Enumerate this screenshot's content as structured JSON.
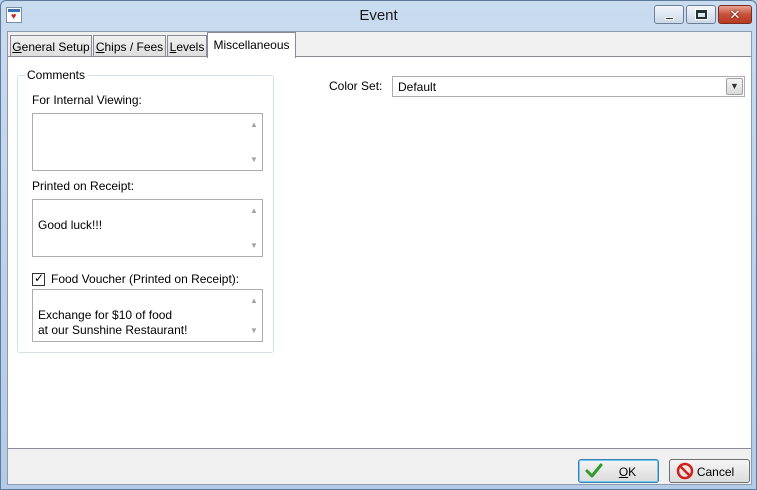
{
  "window": {
    "title": "Event",
    "close_glyph": "✕"
  },
  "tabs": [
    {
      "label": "General Setup",
      "accel": "G",
      "rest": "eneral Setup"
    },
    {
      "label": "Chips / Fees",
      "accel": "C",
      "rest": "hips / Fees"
    },
    {
      "label": "Levels",
      "accel": "L",
      "rest": "evels"
    },
    {
      "label": "Miscellaneous",
      "accel": "",
      "rest": "Miscellaneous"
    }
  ],
  "comments": {
    "group_title": "Comments",
    "internal_label": "For Internal Viewing:",
    "internal_value": "",
    "receipt_label": "Printed on Receipt:",
    "receipt_value": "Good luck!!!",
    "voucher_label": "Food Voucher (Printed on Receipt):",
    "voucher_checked": true,
    "voucher_value": "Exchange for $10 of food\nat our Sunshine Restaurant!"
  },
  "color_set": {
    "label": "Color Set:",
    "value": "Default"
  },
  "buttons": {
    "ok": {
      "accel": "O",
      "rest": "K"
    },
    "cancel": {
      "label": "Cancel"
    }
  },
  "colors": {
    "ok_icon": "#2e9b2e",
    "cancel_icon": "#d0201a"
  },
  "icons": {
    "app": "app-event-icon",
    "ok": "checkmark-icon",
    "cancel": "no-entry-icon"
  }
}
